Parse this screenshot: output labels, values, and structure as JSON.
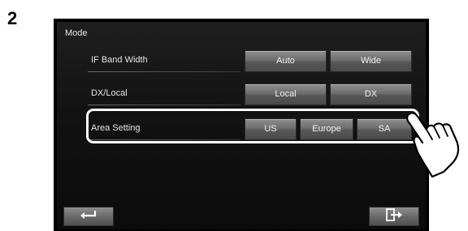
{
  "step_number": "2",
  "screen": {
    "title": "Mode",
    "rows": [
      {
        "label": "IF Band Width",
        "options": [
          "Auto",
          "Wide"
        ]
      },
      {
        "label": "DX/Local",
        "options": [
          "Local",
          "DX"
        ]
      },
      {
        "label": "Area Setting",
        "options": [
          "US",
          "Europe",
          "SA"
        ]
      }
    ],
    "highlighted_row": "Area Setting",
    "pointed_option": "SA"
  },
  "footer": {
    "back_icon": "return-arrow-icon",
    "exit_icon": "exit-screen-icon"
  }
}
